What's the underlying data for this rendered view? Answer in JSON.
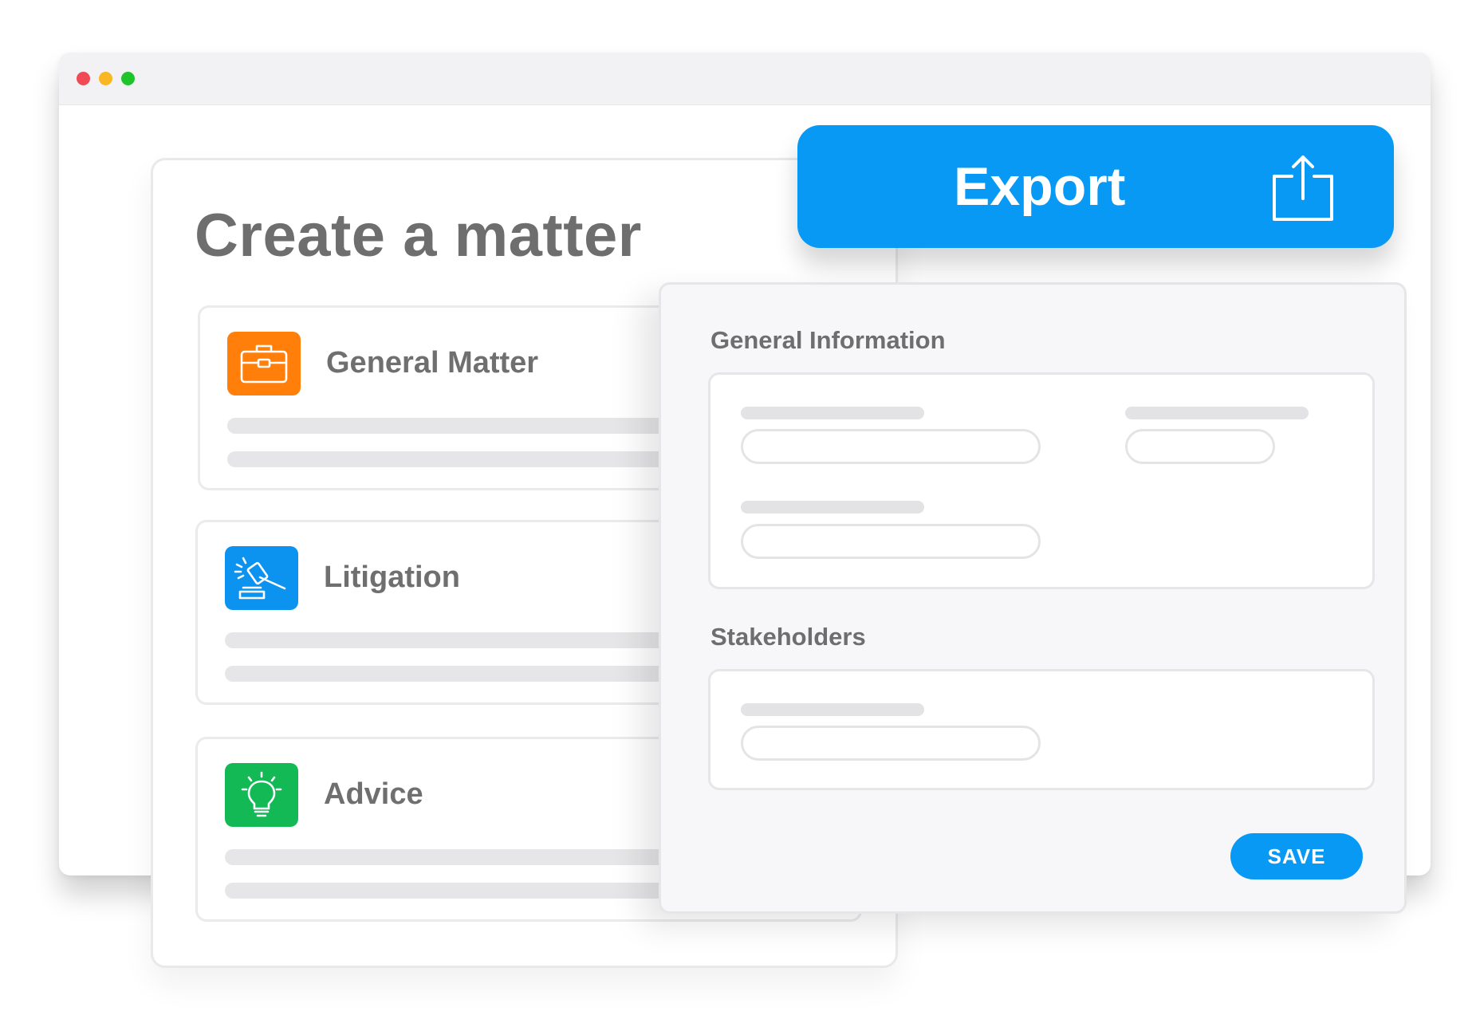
{
  "window": {
    "controls": [
      "close",
      "minimize",
      "maximize"
    ]
  },
  "matter": {
    "title": "Create a matter",
    "types": [
      {
        "label": "General Matter",
        "icon": "briefcase-icon",
        "color": "#ff7f0a"
      },
      {
        "label": "Litigation",
        "icon": "gavel-icon",
        "color": "#0b93ef"
      },
      {
        "label": "Advice",
        "icon": "lightbulb-icon",
        "color": "#13b954"
      }
    ]
  },
  "export": {
    "label": "Export",
    "icon": "share-export-icon"
  },
  "form": {
    "general_information_title": "General Information",
    "stakeholders_title": "Stakeholders",
    "save_label": "SAVE"
  },
  "colors": {
    "accent": "#0899f5",
    "text": "#6e6e6e",
    "placeholder": "#e4e4e6"
  }
}
